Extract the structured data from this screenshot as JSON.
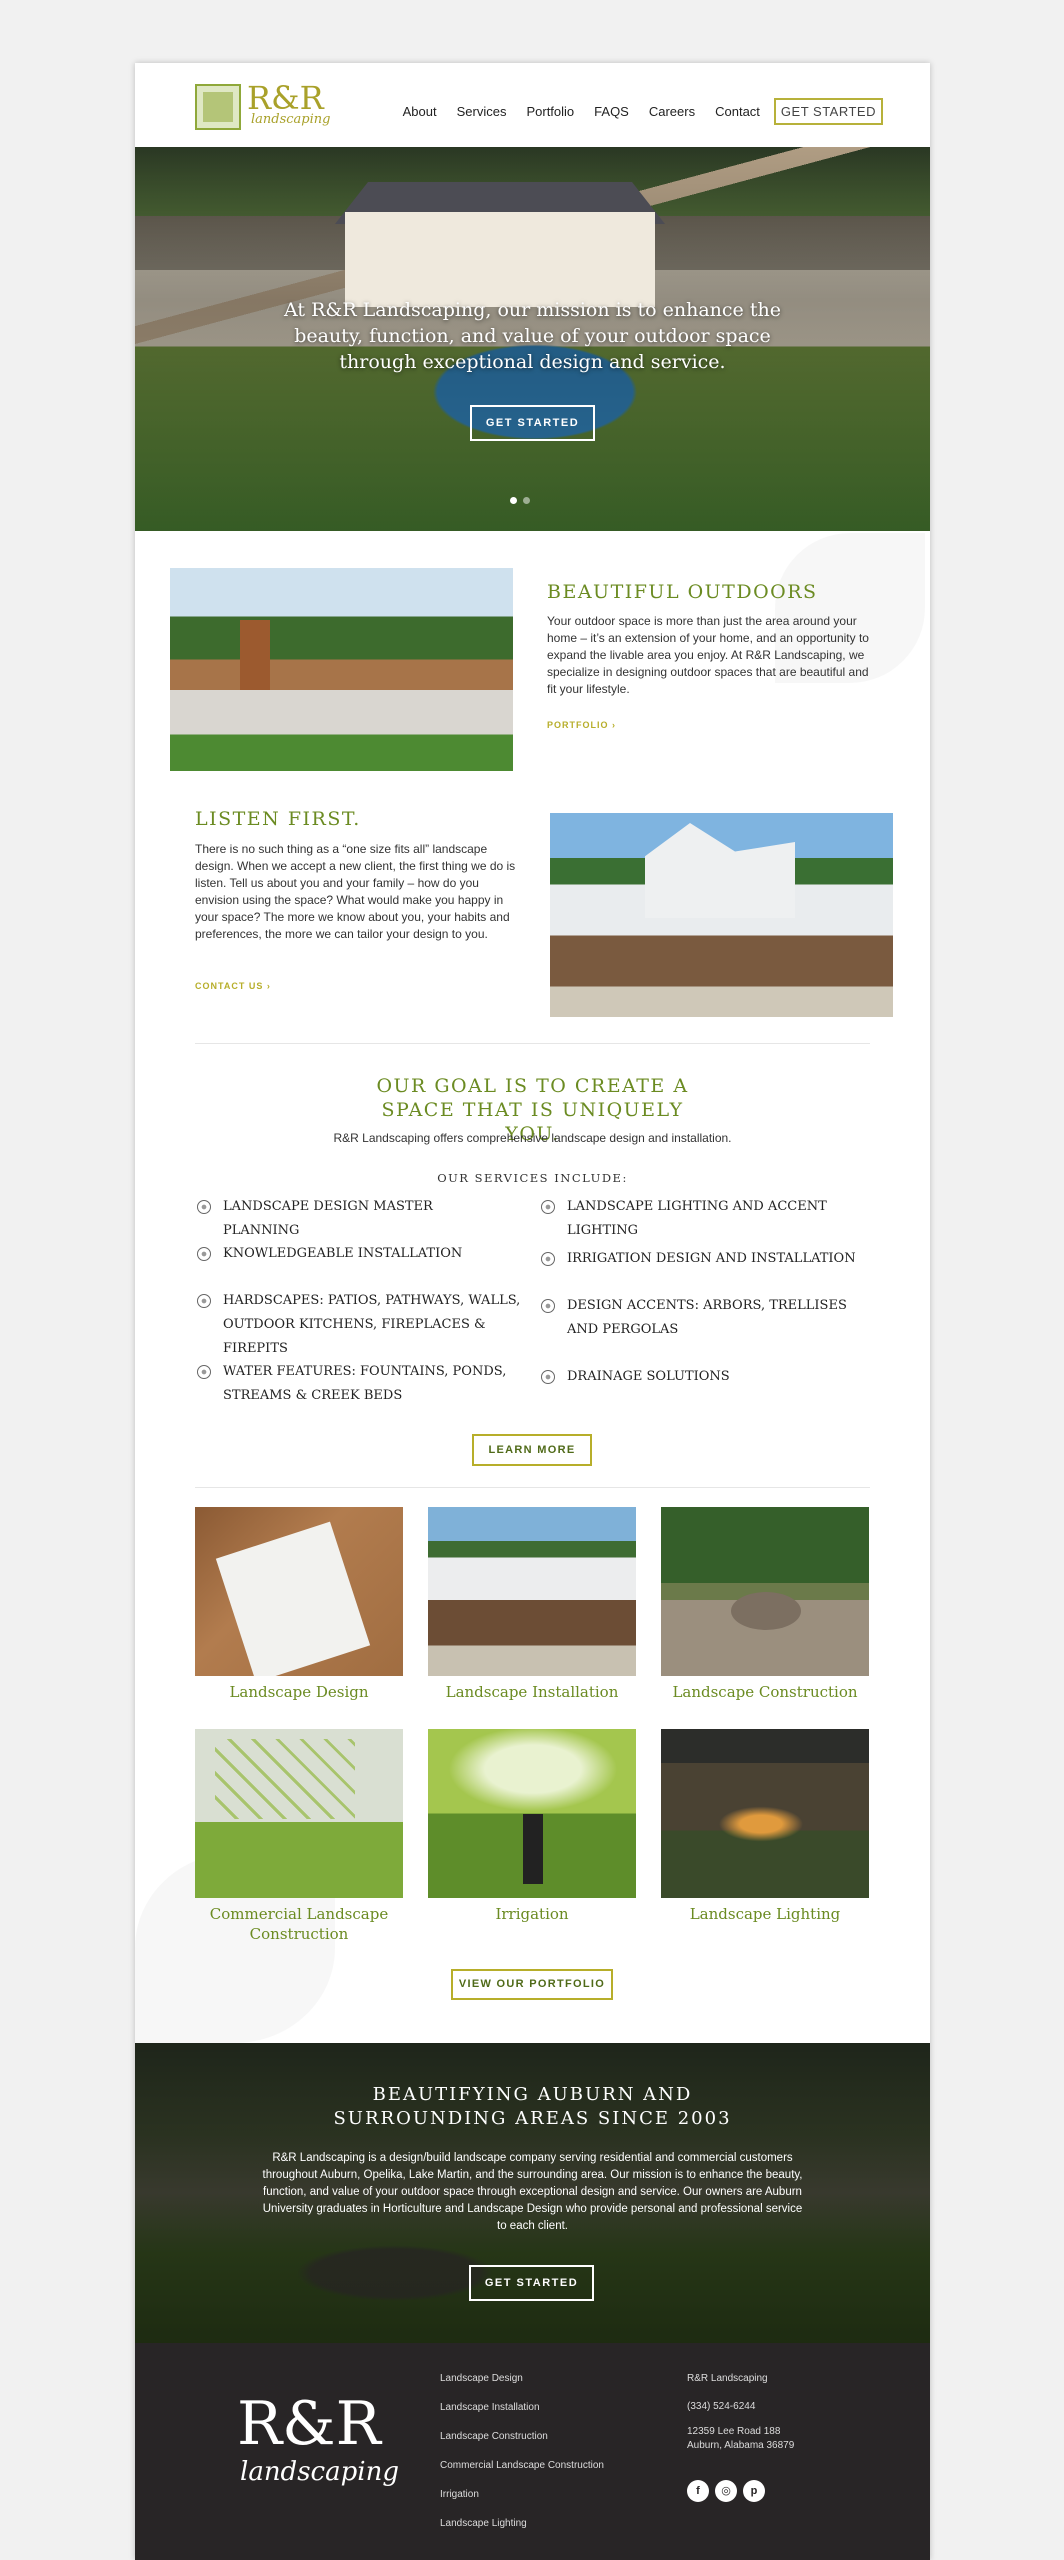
{
  "header": {
    "logo_main": "R&R",
    "logo_sub": "landscaping",
    "nav": [
      "About",
      "Services",
      "Portfolio",
      "FAQS",
      "Careers",
      "Contact"
    ],
    "cta": "GET STARTED"
  },
  "hero": {
    "text": "At R&R Landscaping, our mission is to enhance the beauty, function, and value of your outdoor space through exceptional design and service.",
    "button": "GET STARTED"
  },
  "outdoors": {
    "title": "BEAUTIFUL OUTDOORS",
    "text": "Your outdoor space is more than just the area around your home – it’s an extension of your home, and an opportunity to expand the livable area you enjoy. At R&R Landscaping, we specialize in designing outdoor spaces that are beautiful and fit your lifestyle.",
    "link": "PORTFOLIO ›"
  },
  "listen": {
    "title": "LISTEN FIRST.",
    "text": "There is no such thing as a “one size fits all” landscape design. When we accept a new client, the first thing we do is listen. Tell us about you and your family – how do you envision using the space? What would make you happy in your space? The more we know about you, your habits and preferences, the more we can tailor your design to you.",
    "link": "CONTACT US ›"
  },
  "goal": {
    "title": "OUR GOAL IS TO CREATE A SPACE THAT IS UNIQUELY YOU.",
    "sub": "R&R Landscaping offers comprehensive landscape design and installation.",
    "services_heading": "OUR SERVICES INCLUDE:",
    "services_left": [
      "LANDSCAPE DESIGN MASTER PLANNING",
      "KNOWLEDGEABLE INSTALLATION",
      "HARDSCAPES: PATIOS, PATHWAYS, WALLS, OUTDOOR KITCHENS, FIREPLACES & FIREPITS",
      "WATER FEATURES: FOUNTAINS, PONDS, STREAMS & CREEK BEDS"
    ],
    "services_right": [
      "LANDSCAPE LIGHTING AND ACCENT LIGHTING",
      "IRRIGATION DESIGN AND INSTALLATION",
      "DESIGN ACCENTS: ARBORS, TRELLISES AND PERGOLAS",
      "DRAINAGE SOLUTIONS"
    ],
    "button": "LEARN MORE"
  },
  "gallery": {
    "items": [
      "Landscape Design",
      "Landscape Installation",
      "Landscape Construction",
      "Commercial Landscape Construction",
      "Irrigation",
      "Landscape Lighting"
    ],
    "button": "VIEW OUR PORTFOLIO"
  },
  "banner": {
    "title": "BEAUTIFYING AUBURN AND SURROUNDING AREAS SINCE 2003",
    "text": "R&R Landscaping is a design/build landscape company serving residential and commercial customers throughout Auburn, Opelika, Lake Martin, and the surrounding area. Our mission is to enhance the beauty, function, and value of your outdoor space through exceptional design and service. Our owners are Auburn University graduates in Horticulture and Landscape Design who provide personal and professional service to each client.",
    "button": "GET STARTED"
  },
  "footer": {
    "logo_main": "R&R",
    "logo_sub": "landscaping",
    "links": [
      "Landscape Design",
      "Landscape Installation",
      "Landscape Construction",
      "Commercial Landscape Construction",
      "Irrigation",
      "Landscape Lighting"
    ],
    "company": "R&R Landscaping",
    "phone": "(334) 524-6244",
    "address1": "12359 Lee Road 188",
    "address2": "Auburn, Alabama 36879",
    "social": [
      "f",
      "◎",
      "p"
    ]
  },
  "colors": {
    "accent_green": "#6b8b22",
    "accent_gold": "#b7ae2a",
    "footer_bg": "#282526"
  }
}
